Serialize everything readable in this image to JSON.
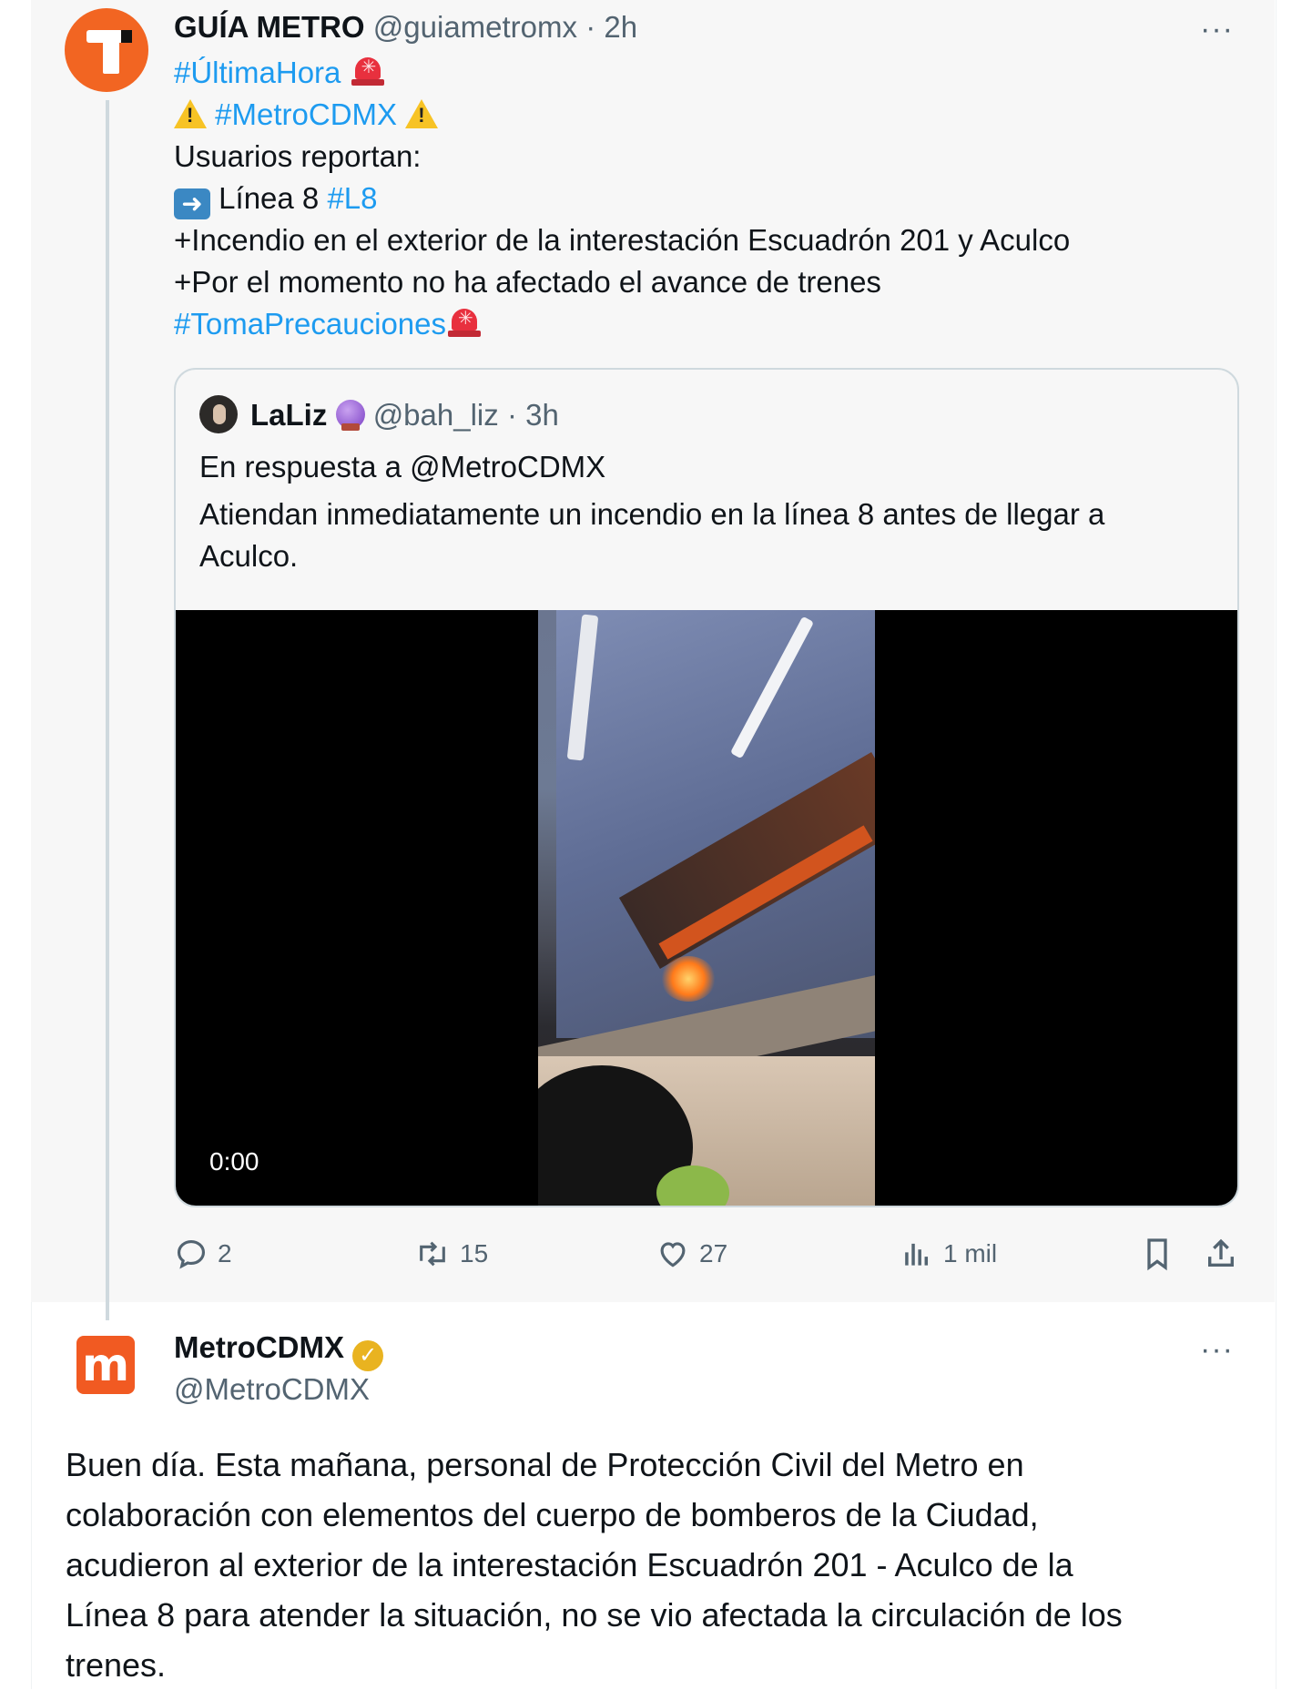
{
  "tweet": {
    "author_name": "GUÍA METRO",
    "author_handle": "@guiametromx",
    "time": "· 2h",
    "more_label": "···",
    "hashtag_ultima": "#ÚltimaHora",
    "hashtag_metro": "#MetroCDMX",
    "line_usuarios": "Usuarios reportan:",
    "line_linea": "Línea 8",
    "hashtag_l8": "#L8",
    "line_incendio": "+Incendio en el exterior de la interestación Escuadrón 201  y Aculco",
    "line_momento": "+Por el momento no ha afectado el avance de trenes",
    "hashtag_toma": "#TomaPrecauciones",
    "emoji_siren": "siren-emoji",
    "emoji_warning": "warning-emoji",
    "emoji_arrow": "right-arrow-emoji"
  },
  "quote": {
    "author_name": "LaLiz",
    "author_emoji": "crystal-ball-emoji",
    "author_handle": "@bah_liz",
    "time": "· 3h",
    "reply_to": "En respuesta a @MetroCDMX",
    "text_line1": "Atiendan inmediatamente un incendio en la línea 8 antes de llegar a",
    "text_line2": "Aculco.",
    "video_time": "0:00"
  },
  "actions": {
    "replies": "2",
    "retweets": "15",
    "likes": "27",
    "views": "1 mil",
    "icons": [
      "reply-icon",
      "retweet-icon",
      "like-icon",
      "views-icon",
      "bookmark-icon",
      "share-icon"
    ]
  },
  "reply": {
    "author_name": "MetroCDMX",
    "author_handle": "@MetroCDMX",
    "more_label": "···",
    "verified_icon": "verified-badge-icon",
    "lines": [
      "Buen día. Esta mañana, personal de Protección Civil del Metro en",
      "colaboración con elementos del cuerpo de bomberos de la Ciudad,",
      "acudieron al exterior de la interestación Escuadrón 201 - Aculco de la",
      "Línea 8 para atender la situación, no se vio afectada la circulación de los",
      "trenes."
    ]
  },
  "colors": {
    "link": "#1d9bf0",
    "text": "#0f1419",
    "muted": "#536471",
    "guia_orange": "#f26522",
    "metro_orange": "#f15a22",
    "verified_gold": "#e9b320"
  }
}
